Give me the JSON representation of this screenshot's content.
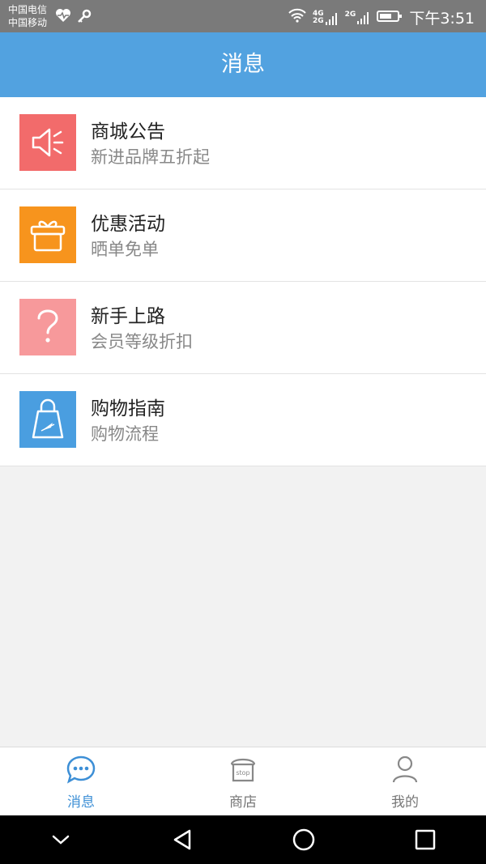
{
  "status_bar": {
    "carrier_1": "中国电信",
    "carrier_2": "中国移动",
    "network_a": "4G",
    "network_b": "2G",
    "network_c": "2G",
    "time": "下午3:51"
  },
  "header": {
    "title": "消息"
  },
  "messages": [
    {
      "title": "商城公告",
      "subtitle": "新进品牌五折起",
      "icon": "megaphone-icon",
      "color": "#f26b6b"
    },
    {
      "title": "优惠活动",
      "subtitle": "晒单免单",
      "icon": "gift-icon",
      "color": "#f7941d"
    },
    {
      "title": "新手上路",
      "subtitle": "会员等级折扣",
      "icon": "question-icon",
      "color": "#f7999b"
    },
    {
      "title": "购物指南",
      "subtitle": "购物流程",
      "icon": "shopping-bag-icon",
      "color": "#4a9ee0"
    }
  ],
  "tabs": [
    {
      "label": "消息",
      "icon": "chat-icon",
      "active": true
    },
    {
      "label": "商店",
      "icon": "store-icon",
      "icon_text": "stop",
      "active": false
    },
    {
      "label": "我的",
      "icon": "user-icon",
      "active": false
    }
  ],
  "colors": {
    "accent": "#52a2e0",
    "tab_active": "#3d8fd6"
  }
}
